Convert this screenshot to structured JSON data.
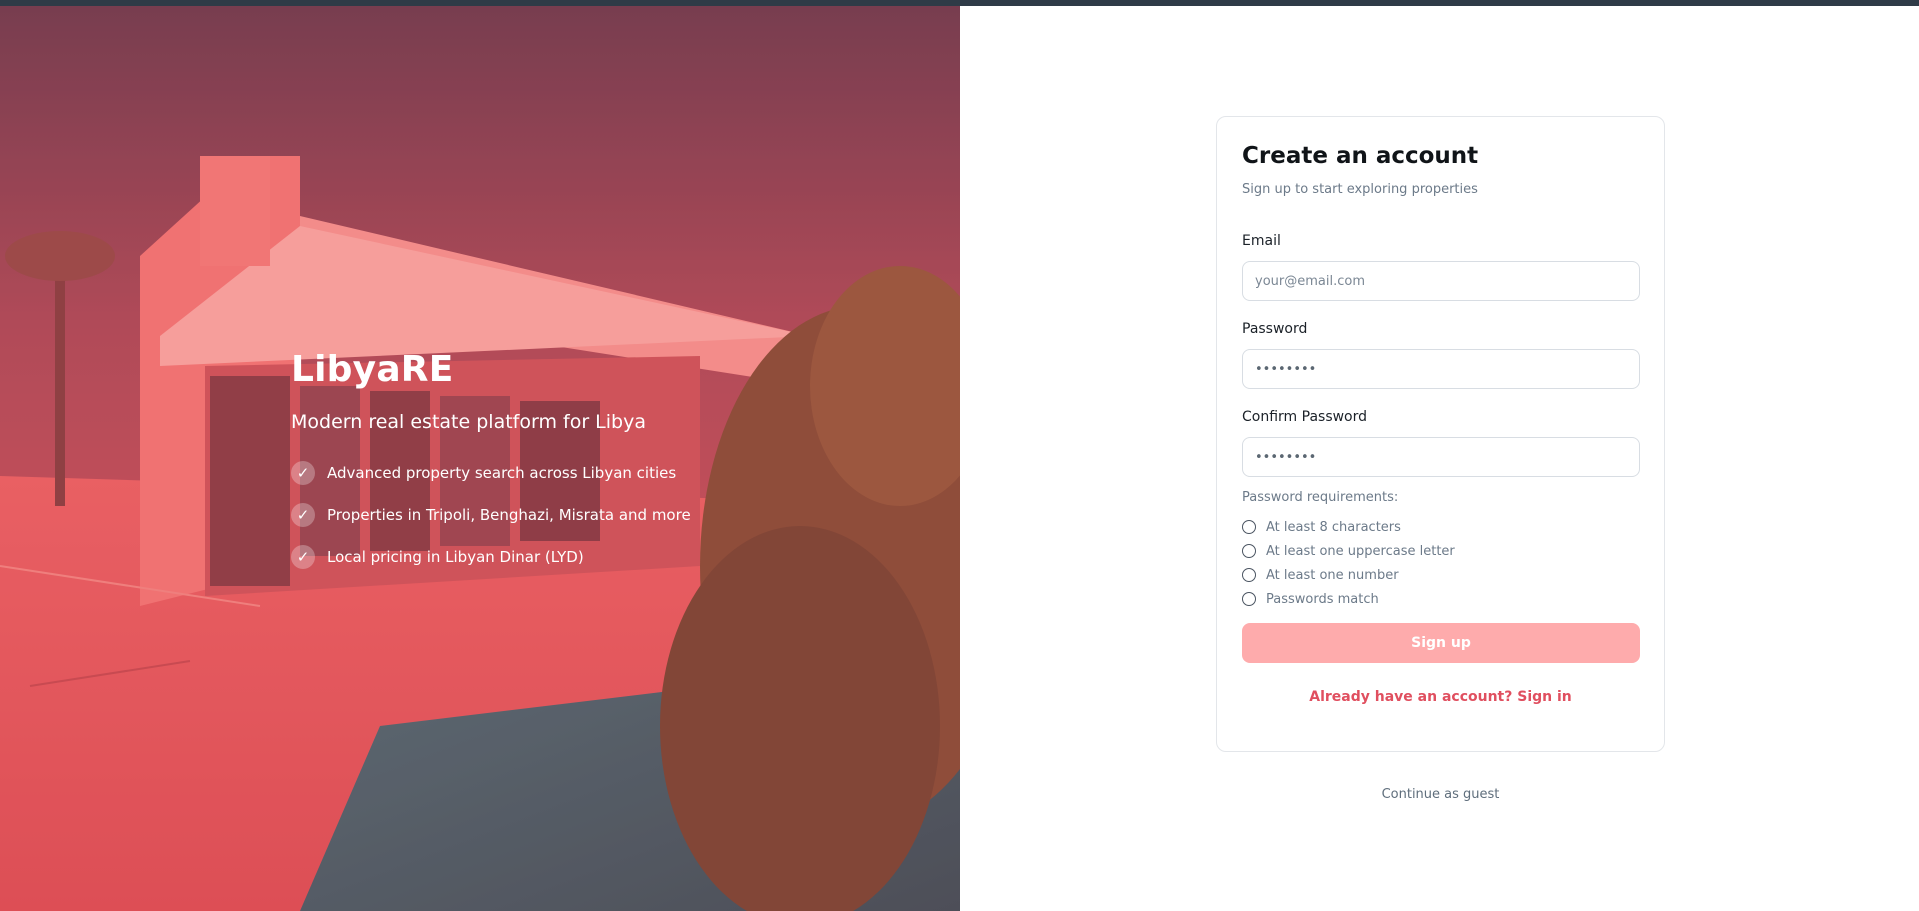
{
  "hero": {
    "title": "LibyaRE",
    "tagline": "Modern real estate platform for Libya",
    "features": [
      "Advanced property search across Libyan cities",
      "Properties in Tripoli, Benghazi, Misrata and more",
      "Local pricing in Libyan Dinar (LYD)"
    ],
    "check_glyph": "✓",
    "icon": "check-icon",
    "tint_color": "#e9595d"
  },
  "form": {
    "title": "Create an account",
    "subtitle": "Sign up to start exploring properties",
    "email_label": "Email",
    "email_placeholder": "your@email.com",
    "password_label": "Password",
    "password_value": "••••••••",
    "confirm_label": "Confirm Password",
    "confirm_value": "••••••••",
    "requirements_title": "Password requirements:",
    "requirements": [
      "At least 8 characters",
      "At least one uppercase letter",
      "At least one number",
      "Passwords match"
    ],
    "signup_label": "Sign up",
    "signin_link": "Already have an account? Sign in",
    "accent_color": "#e04f5f",
    "button_color": "#feabac"
  },
  "guest_link": "Continue as guest"
}
